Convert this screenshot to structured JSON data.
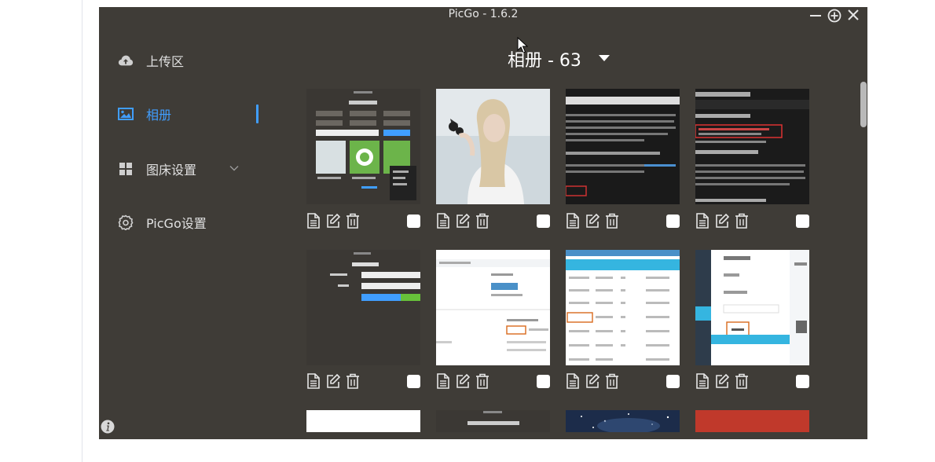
{
  "window": {
    "title": "PicGo - 1.6.2"
  },
  "sidebar": {
    "items": [
      {
        "label": "上传区",
        "icon": "cloud-upload-icon"
      },
      {
        "label": "相册",
        "icon": "picture-icon",
        "active": true
      },
      {
        "label": "图床设置",
        "icon": "grid-icon",
        "expandable": true
      },
      {
        "label": "PicGo设置",
        "icon": "gear-icon"
      }
    ]
  },
  "gallery": {
    "title": "相册 - 63",
    "actions": [
      "file-icon",
      "edit-icon",
      "delete-icon"
    ],
    "images": [
      {
        "theme": "picgo-screenshot",
        "checked": false
      },
      {
        "theme": "woman-photo",
        "checked": false
      },
      {
        "theme": "imgur-docs-dark",
        "checked": false
      },
      {
        "theme": "imgur-settings-dark",
        "checked": false
      },
      {
        "theme": "imgur-form-dark",
        "checked": false
      },
      {
        "theme": "storage-dashboard",
        "checked": false
      },
      {
        "theme": "data-table",
        "checked": false
      },
      {
        "theme": "bucket-list",
        "checked": false
      },
      {
        "theme": "blank-white",
        "checked": false
      },
      {
        "theme": "github-screenshot",
        "checked": false
      },
      {
        "theme": "night-sky",
        "checked": false
      },
      {
        "theme": "red-banner",
        "checked": false
      }
    ]
  },
  "colors": {
    "accent": "#409eff",
    "background": "#3f3c37",
    "text": "#dddddd"
  }
}
